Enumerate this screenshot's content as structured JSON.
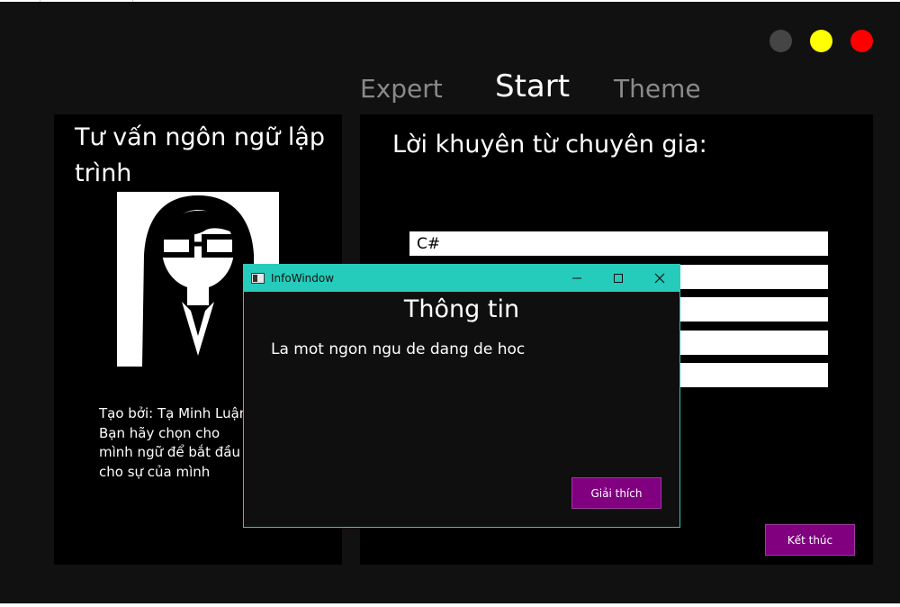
{
  "tabs": {
    "expert": "Expert",
    "start": "Start",
    "theme": "Theme"
  },
  "window_controls": {
    "colors": [
      "#454545",
      "#ffff00",
      "#ff0000"
    ]
  },
  "left_panel": {
    "title": "Tư vấn ngôn ngữ lập trình",
    "credit_line": "Tạo bởi: Tạ Minh Luận",
    "instruction_visible": "Bạn hãy chọn cho mình ngữ để bắt đầu cho sự của mình"
  },
  "right_panel": {
    "title": "Lời khuyên từ chuyên gia:",
    "answers": [
      "C#",
      "",
      "",
      "",
      ""
    ],
    "end_button": "Kết thúc"
  },
  "dialog": {
    "window_title": "InfoWindow",
    "heading": "Thông tin",
    "body": "La mot ngon ngu de dang de hoc",
    "explain_button": "Giải thích"
  },
  "colors": {
    "background": "#111111",
    "panel": "#000000",
    "accent_purple": "#800080",
    "dialog_titlebar": "#25cbbb"
  }
}
